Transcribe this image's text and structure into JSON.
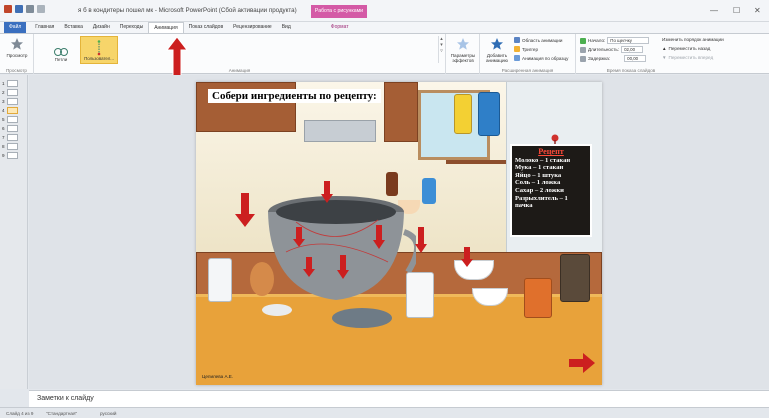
{
  "window": {
    "title": "я б в кондитеры пошел мк - Microsoft PowerPoint (Сбой активации продукта)",
    "context_tab": "Работа с рисунками",
    "controls": {
      "minimize": "—",
      "maximize": "☐",
      "close": "✕"
    }
  },
  "tabs": {
    "file": "Файл",
    "items": [
      "Главная",
      "Вставка",
      "Дизайн",
      "Переходы",
      "Анимация",
      "Показ слайдов",
      "Рецензирование",
      "Вид"
    ],
    "active_index": 4,
    "context": "Формат"
  },
  "ribbon": {
    "preview": {
      "label": "Просмотр",
      "group": "Просмотр"
    },
    "animation_group": "Анимация",
    "gallery": [
      {
        "label": "Петли"
      },
      {
        "label": "Пользовател..."
      }
    ],
    "effect_params": "Параметры эффектов",
    "add_animation": "Добавить анимацию",
    "area_animation": "Область анимации",
    "trigger": "Триггер",
    "anim_by_sample": "Анимация по образцу",
    "advanced_group": "Расширенная анимация",
    "start_label": "Начало:",
    "start_value": "По щелчку",
    "duration_label": "Длительность:",
    "duration_value": "02,00",
    "delay_label": "Задержка:",
    "delay_value": "00,00",
    "timing_group": "Время показа слайдов",
    "reorder_label": "Изменить порядок анимации",
    "move_back": "Переместить назад",
    "move_forward": "Переместить вперед"
  },
  "thumbnails": [
    "1",
    "2",
    "3",
    "4",
    "5",
    "6",
    "7",
    "8",
    "9"
  ],
  "selected_thumbnail": 3,
  "slide": {
    "title": "Собери ингредиенты по рецепту:",
    "recipe_heading": "Рецепт",
    "recipe_lines": [
      "Молоко – 1 стакан",
      "Мука – 1 стакан",
      "Яйцо – 1 штука",
      "Соль – 1 ложка",
      "Сахар – 2 ложки",
      "Разрыхлитель – 1 пачка"
    ],
    "author": "Цепилева А.Е."
  },
  "notes": {
    "text": "Заметки к слайду"
  },
  "status": {
    "slide": "Слайд 4 из 9",
    "theme": "\"Стандартная\"",
    "language": "русский"
  },
  "colors": {
    "accent": "#3a6fbf",
    "context": "#d45aa6",
    "arrow": "#cc1f1f",
    "selected": "#f7d56a"
  }
}
